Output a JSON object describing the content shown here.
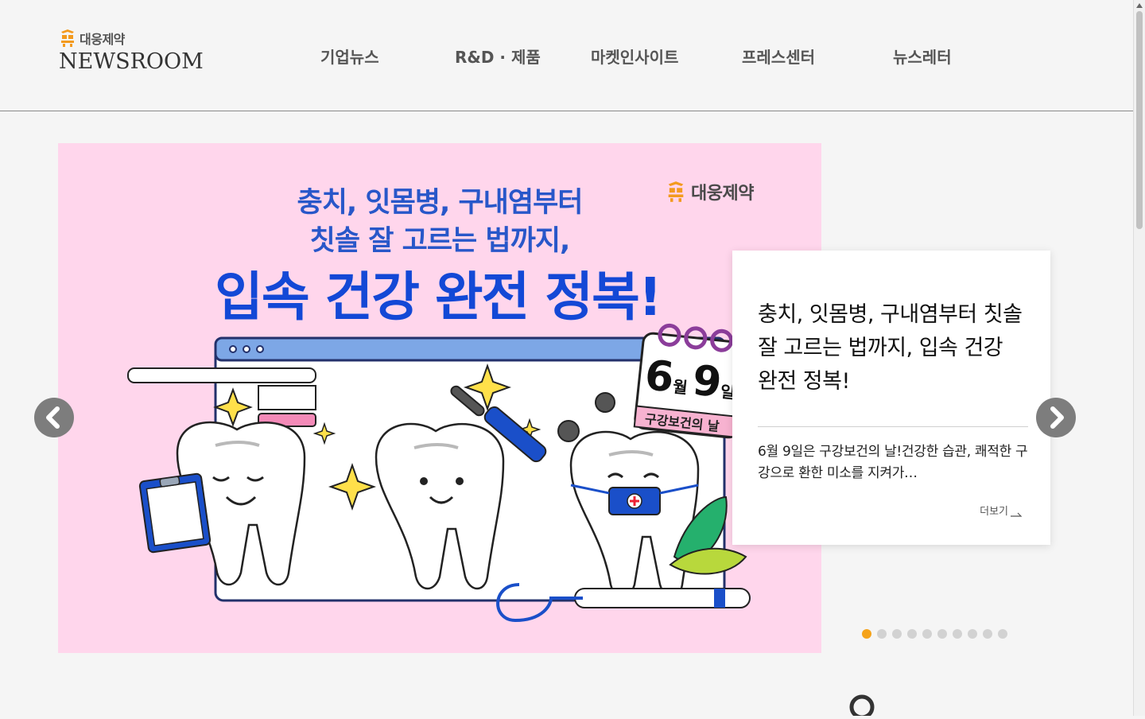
{
  "brand": {
    "name": "대웅제약",
    "newsroom": "NEWSROOM",
    "brand_color": "#f39a1e"
  },
  "nav": {
    "items": [
      {
        "label": "기업뉴스"
      },
      {
        "label": "R&D · 제품"
      },
      {
        "label": "마켓인사이트"
      },
      {
        "label": "프레스센터"
      },
      {
        "label": "뉴스레터"
      }
    ]
  },
  "banner": {
    "background": "#ffd6ec",
    "line1": "충치, 잇몸병, 구내염부터",
    "line2": "칫솔 잘 고르는 법까지,",
    "line3": "입속 건강 완전 정복!",
    "logo_brand": "대웅제약",
    "calendar_month": "6",
    "calendar_month_unit": "월",
    "calendar_day": "9",
    "calendar_day_unit": "일",
    "calendar_caption": "구강보건의 날"
  },
  "card": {
    "title": "충치, 잇몸병, 구내염부터 칫솔 잘 고르는 법까지, 입속 건강 완전 정복!",
    "description": "6월 9일은 구강보건의 날!건강한 습관, 쾌적한 구강으로 환한 미소를 지켜가…",
    "more_label": "더보기"
  },
  "slider": {
    "total_slides": 10,
    "active_index": 0,
    "active_color": "#f5a31a",
    "prev_icon": "chevron-left-icon",
    "next_icon": "chevron-right-icon"
  },
  "search": {
    "icon": "search-icon"
  }
}
